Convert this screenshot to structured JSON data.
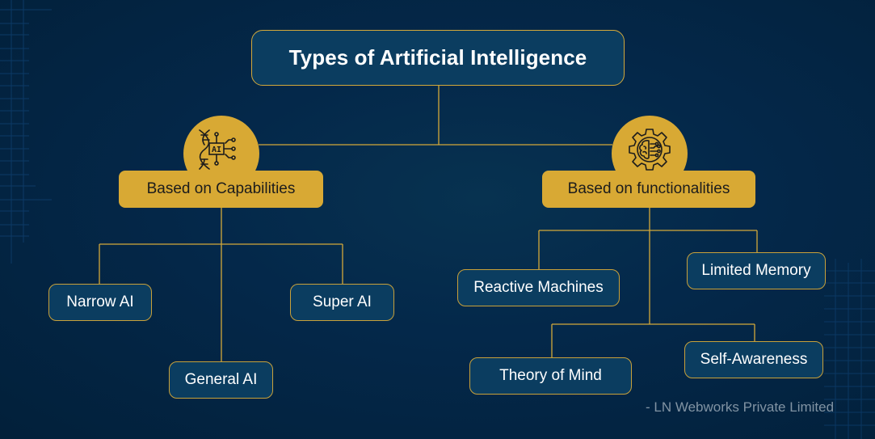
{
  "title": "Types of Artificial Intelligence",
  "colors": {
    "background": "#02203a",
    "box_fill": "#0b3d60",
    "accent_gold": "#d8a934",
    "connector": "#d4a93a",
    "box_text": "#ffffff",
    "category_text": "#1c1c1c",
    "credit_text": "#8193a3"
  },
  "categories": [
    {
      "label": "Based on Capabilities",
      "icon": "ai-dna-chip-icon",
      "children": [
        "Narrow AI",
        "Super AI",
        "General AI"
      ]
    },
    {
      "label": "Based on functionalities",
      "icon": "gear-brain-circuit-icon",
      "children": [
        "Reactive Machines",
        "Limited Memory",
        "Theory of Mind",
        "Self-Awareness"
      ]
    }
  ],
  "icon_text": {
    "ai_chip": "AI"
  },
  "credit": "- LN Webworks Private Limited"
}
